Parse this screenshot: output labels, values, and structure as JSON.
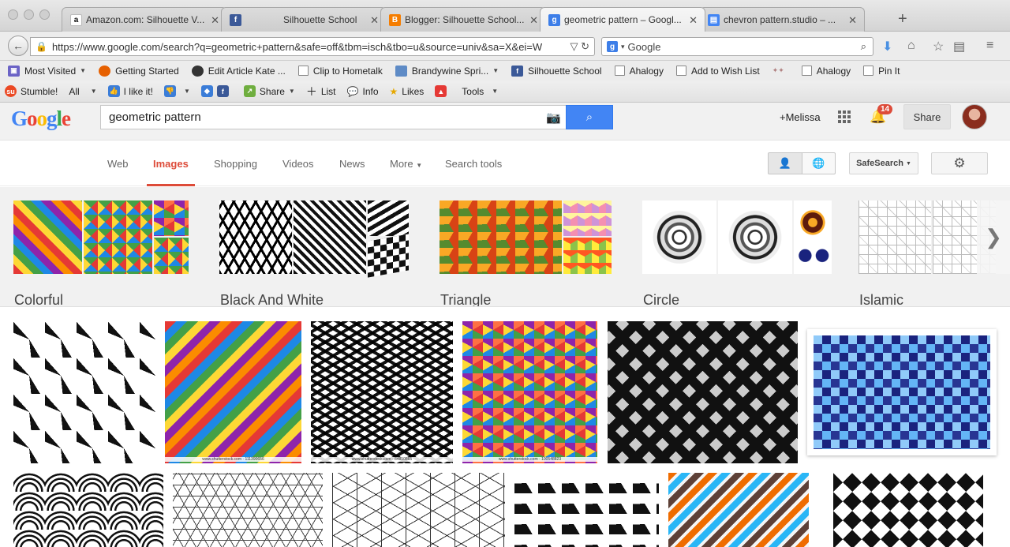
{
  "browser": {
    "tabs": [
      {
        "title": "Amazon.com: Silhouette V...",
        "favicon": "a",
        "color": "#ffffff",
        "fg": "#111111",
        "active": false
      },
      {
        "title": "Silhouette School",
        "favicon": "f",
        "color": "#3b5998",
        "fg": "#ffffff",
        "active": false
      },
      {
        "title": "Blogger: Silhouette School...",
        "favicon": "B",
        "color": "#f57d00",
        "fg": "#ffffff",
        "active": false
      },
      {
        "title": "geometric pattern – Googl...",
        "favicon": "g",
        "color": "#3d7ee8",
        "fg": "#ffffff",
        "active": true
      },
      {
        "title": "chevron pattern.studio – ...",
        "favicon": "▤",
        "color": "#4285f4",
        "fg": "#ffffff",
        "active": false
      }
    ],
    "url": "https://www.google.com/search?q=geometric+pattern&safe=off&tbm=isch&tbo=u&source=univ&sa=X&ei=W",
    "search_placeholder": "Google",
    "bookmarks": [
      {
        "label": "Most Visited",
        "icon": "folder-icon",
        "color": "#6b63c6",
        "dropdown": true
      },
      {
        "label": "Getting Started",
        "icon": "firefox-icon",
        "color": "#e66000",
        "dropdown": false
      },
      {
        "label": "Edit Article Kate ...",
        "icon": "dot-icon",
        "color": "#333333",
        "dropdown": false
      },
      {
        "label": "Clip to Hometalk",
        "icon": "page-icon",
        "color": "",
        "dropdown": false
      },
      {
        "label": "Brandywine Spri...",
        "icon": "folder-icon",
        "color": "#5e8bc6",
        "dropdown": true
      },
      {
        "label": "Silhouette School",
        "icon": "facebook-icon",
        "color": "#3b5998",
        "dropdown": false
      },
      {
        "label": "Ahalogy",
        "icon": "page-icon",
        "color": "",
        "dropdown": false
      },
      {
        "label": "Add to Wish List",
        "icon": "page-icon",
        "color": "",
        "dropdown": false
      },
      {
        "label": "Ahalogy",
        "icon": "page-icon",
        "color": "",
        "dropdown": false
      },
      {
        "label": "Pin It",
        "icon": "page-icon",
        "color": "",
        "dropdown": false
      }
    ],
    "stumble_bar": {
      "stumble": "Stumble!",
      "all": "All",
      "like": "I like it!",
      "share": "Share",
      "list": "List",
      "info": "Info",
      "likes": "Likes",
      "tools": "Tools"
    }
  },
  "google": {
    "logo": "Google",
    "query": "geometric pattern",
    "user": "+Melissa",
    "notifications": "14",
    "share_label": "Share",
    "tabs": [
      "Web",
      "Images",
      "Shopping",
      "Videos",
      "News",
      "More",
      "Search tools"
    ],
    "active_tab": "Images",
    "safesearch": "SafeSearch",
    "related": [
      {
        "label": "Colorful"
      },
      {
        "label": "Black And White"
      },
      {
        "label": "Triangle"
      },
      {
        "label": "Circle"
      },
      {
        "label": "Islamic"
      }
    ],
    "watermarks": {
      "img2": "www.shutterstock.com · 111390656",
      "img3": "www.shutterstock.com · 84810865",
      "img4": "www.shutterstock.com · 100548823"
    }
  }
}
